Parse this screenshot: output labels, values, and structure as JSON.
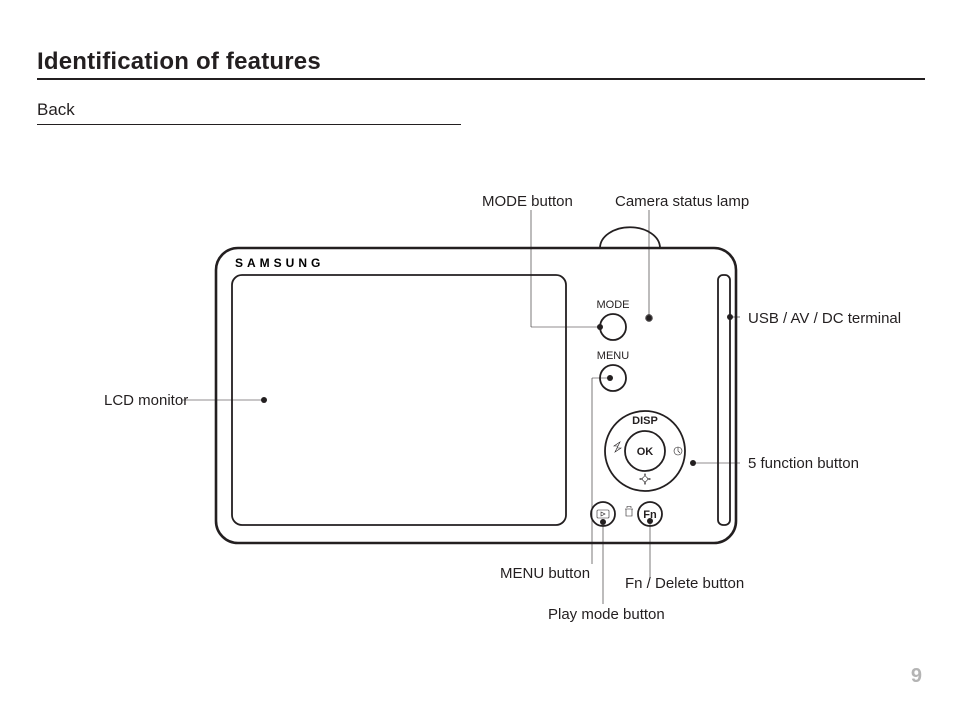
{
  "heading": "Identification of features",
  "subheading": "Back",
  "page_number": "9",
  "labels": {
    "mode_button": "MODE button",
    "camera_status_lamp": "Camera status lamp",
    "lcd_monitor": "LCD monitor",
    "usb_av_dc_terminal": "USB / AV / DC terminal",
    "five_function_button": "5 function button",
    "menu_button": "MENU button",
    "play_mode_button": "Play mode button",
    "fn_delete_button": "Fn / Delete button"
  },
  "camera_text": {
    "brand": "SAMSUNG",
    "mode": "MODE",
    "menu": "MENU",
    "disp": "DISP",
    "ok": "OK",
    "fn": "Fn"
  }
}
